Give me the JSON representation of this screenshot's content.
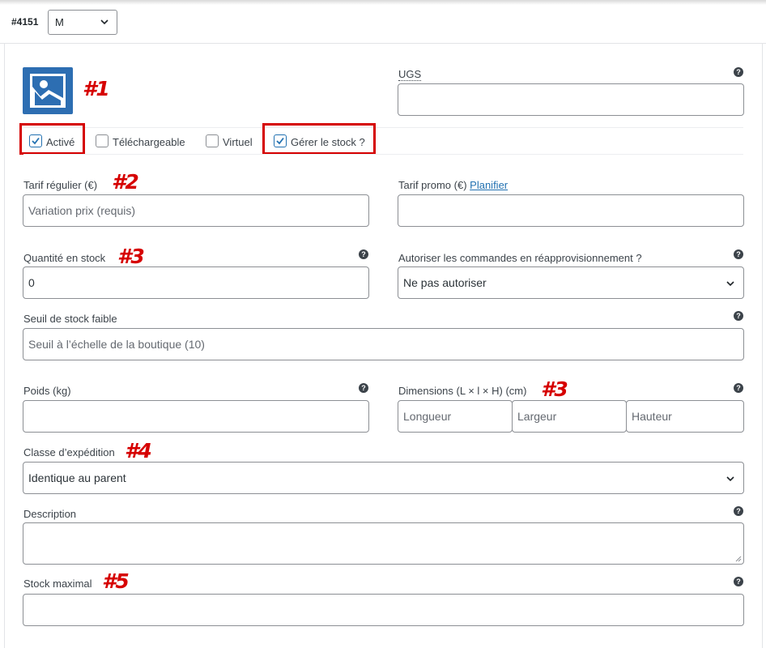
{
  "header": {
    "variation_id": "#4151",
    "variation_select": "M"
  },
  "annotations": {
    "m1": "#1",
    "m2": "#2",
    "m3a": "#3",
    "m3b": "#3",
    "m4": "#4",
    "m5": "#5"
  },
  "options": {
    "enabled": "Activé",
    "downloadable": "Téléchargeable",
    "virtual": "Virtuel",
    "manage_stock": "Gérer le stock ?"
  },
  "fields": {
    "sku_label": "UGS",
    "regular_price_label": "Tarif régulier (€)",
    "regular_price_placeholder": "Variation prix (requis)",
    "sale_price_label": "Tarif promo (€)",
    "sale_schedule_link": "Planifier",
    "stock_qty_label": "Quantité en stock",
    "stock_qty_value": "0",
    "backorders_label": "Autoriser les commandes en réapprovisionnement ?",
    "backorders_value": "Ne pas autoriser",
    "low_stock_label": "Seuil de stock faible",
    "low_stock_placeholder": "Seuil à l’échelle de la boutique (10)",
    "weight_label": "Poids (kg)",
    "dimensions_label": "Dimensions (L × l × H) (cm)",
    "length_placeholder": "Longueur",
    "width_placeholder": "Largeur",
    "height_placeholder": "Hauteur",
    "shipping_class_label": "Classe d’expédition",
    "shipping_class_value": "Identique au parent",
    "description_label": "Description",
    "max_stock_label": "Stock maximal",
    "help_glyph": "?"
  },
  "colors": {
    "annotation_red": "#d60000",
    "link_blue": "#2271b1",
    "thumbnail_blue": "#2d6eb2"
  },
  "icons": [
    "chevron-down-icon",
    "help-icon",
    "image-placeholder-icon",
    "checkmark-icon",
    "resize-grip-icon"
  ]
}
